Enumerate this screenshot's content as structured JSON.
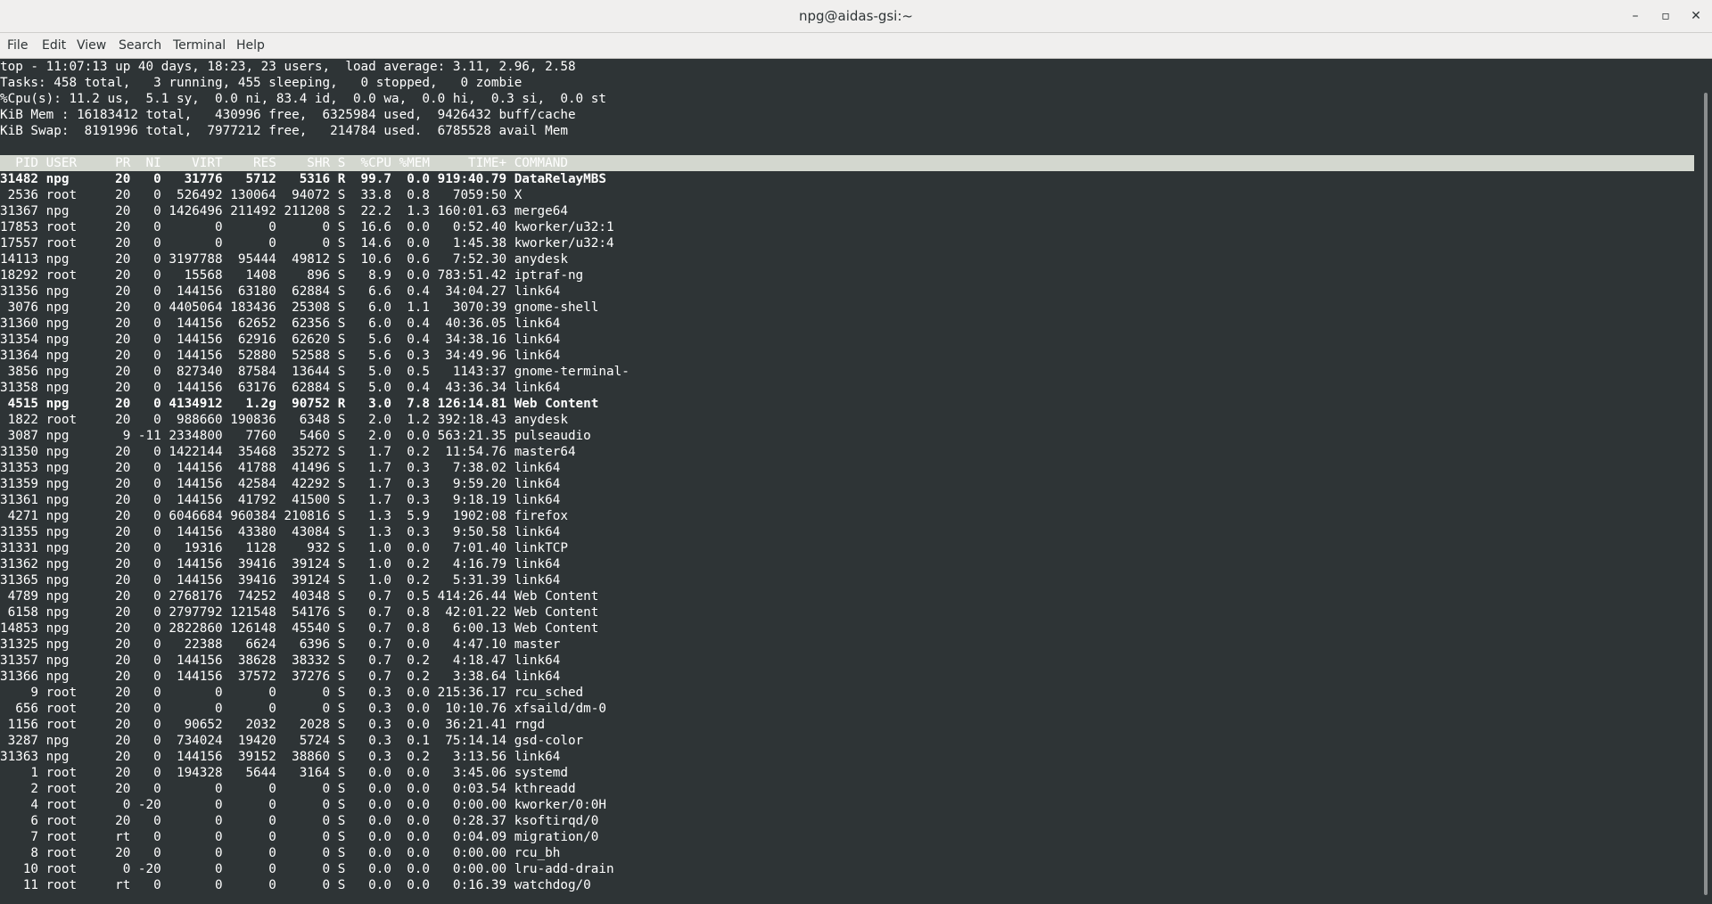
{
  "window": {
    "title": "npg@aidas-gsi:~",
    "minimize_label": "–",
    "maximize_label": "▫",
    "close_label": "✕"
  },
  "menu": [
    "File",
    "Edit",
    "View",
    "Search",
    "Terminal",
    "Help"
  ],
  "summary": [
    "top - 11:07:13 up 40 days, 18:23, 23 users,  load average: 3.11, 2.96, 2.58",
    "Tasks: 458 total,   3 running, 455 sleeping,   0 stopped,   0 zombie",
    "%Cpu(s): 11.2 us,  5.1 sy,  0.0 ni, 83.4 id,  0.0 wa,  0.0 hi,  0.3 si,  0.0 st",
    "KiB Mem : 16183412 total,   430996 free,  6325984 used,  9426432 buff/cache",
    "KiB Swap:  8191996 total,  7977212 free,   214784 used.  6785528 avail Mem"
  ],
  "columns": [
    "PID",
    "USER",
    "PR",
    "NI",
    "VIRT",
    "RES",
    "SHR",
    "S",
    "%CPU",
    "%MEM",
    "TIME+",
    "COMMAND"
  ],
  "processes": [
    {
      "pid": "31482",
      "user": "npg",
      "pr": "20",
      "ni": "0",
      "virt": "31776",
      "res": "5712",
      "shr": "5316",
      "s": "R",
      "cpu": "99.7",
      "mem": "0.0",
      "time": "919:40.79",
      "cmd": "DataRelayMBS",
      "bold": true
    },
    {
      "pid": "2536",
      "user": "root",
      "pr": "20",
      "ni": "0",
      "virt": "526492",
      "res": "130064",
      "shr": "94072",
      "s": "S",
      "cpu": "33.8",
      "mem": "0.8",
      "time": "7059:50",
      "cmd": "X"
    },
    {
      "pid": "31367",
      "user": "npg",
      "pr": "20",
      "ni": "0",
      "virt": "1426496",
      "res": "211492",
      "shr": "211208",
      "s": "S",
      "cpu": "22.2",
      "mem": "1.3",
      "time": "160:01.63",
      "cmd": "merge64"
    },
    {
      "pid": "17853",
      "user": "root",
      "pr": "20",
      "ni": "0",
      "virt": "0",
      "res": "0",
      "shr": "0",
      "s": "S",
      "cpu": "16.6",
      "mem": "0.0",
      "time": "0:52.40",
      "cmd": "kworker/u32:1"
    },
    {
      "pid": "17557",
      "user": "root",
      "pr": "20",
      "ni": "0",
      "virt": "0",
      "res": "0",
      "shr": "0",
      "s": "S",
      "cpu": "14.6",
      "mem": "0.0",
      "time": "1:45.38",
      "cmd": "kworker/u32:4"
    },
    {
      "pid": "14113",
      "user": "npg",
      "pr": "20",
      "ni": "0",
      "virt": "3197788",
      "res": "95444",
      "shr": "49812",
      "s": "S",
      "cpu": "10.6",
      "mem": "0.6",
      "time": "7:52.30",
      "cmd": "anydesk"
    },
    {
      "pid": "18292",
      "user": "root",
      "pr": "20",
      "ni": "0",
      "virt": "15568",
      "res": "1408",
      "shr": "896",
      "s": "S",
      "cpu": "8.9",
      "mem": "0.0",
      "time": "783:51.42",
      "cmd": "iptraf-ng"
    },
    {
      "pid": "31356",
      "user": "npg",
      "pr": "20",
      "ni": "0",
      "virt": "144156",
      "res": "63180",
      "shr": "62884",
      "s": "S",
      "cpu": "6.6",
      "mem": "0.4",
      "time": "34:04.27",
      "cmd": "link64"
    },
    {
      "pid": "3076",
      "user": "npg",
      "pr": "20",
      "ni": "0",
      "virt": "4405064",
      "res": "183436",
      "shr": "25308",
      "s": "S",
      "cpu": "6.0",
      "mem": "1.1",
      "time": "3070:39",
      "cmd": "gnome-shell"
    },
    {
      "pid": "31360",
      "user": "npg",
      "pr": "20",
      "ni": "0",
      "virt": "144156",
      "res": "62652",
      "shr": "62356",
      "s": "S",
      "cpu": "6.0",
      "mem": "0.4",
      "time": "40:36.05",
      "cmd": "link64"
    },
    {
      "pid": "31354",
      "user": "npg",
      "pr": "20",
      "ni": "0",
      "virt": "144156",
      "res": "62916",
      "shr": "62620",
      "s": "S",
      "cpu": "5.6",
      "mem": "0.4",
      "time": "34:38.16",
      "cmd": "link64"
    },
    {
      "pid": "31364",
      "user": "npg",
      "pr": "20",
      "ni": "0",
      "virt": "144156",
      "res": "52880",
      "shr": "52588",
      "s": "S",
      "cpu": "5.6",
      "mem": "0.3",
      "time": "34:49.96",
      "cmd": "link64"
    },
    {
      "pid": "3856",
      "user": "npg",
      "pr": "20",
      "ni": "0",
      "virt": "827340",
      "res": "87584",
      "shr": "13644",
      "s": "S",
      "cpu": "5.0",
      "mem": "0.5",
      "time": "1143:37",
      "cmd": "gnome-terminal-"
    },
    {
      "pid": "31358",
      "user": "npg",
      "pr": "20",
      "ni": "0",
      "virt": "144156",
      "res": "63176",
      "shr": "62884",
      "s": "S",
      "cpu": "5.0",
      "mem": "0.4",
      "time": "43:36.34",
      "cmd": "link64"
    },
    {
      "pid": "4515",
      "user": "npg",
      "pr": "20",
      "ni": "0",
      "virt": "4134912",
      "res": "1.2g",
      "shr": "90752",
      "s": "R",
      "cpu": "3.0",
      "mem": "7.8",
      "time": "126:14.81",
      "cmd": "Web Content",
      "bold": true
    },
    {
      "pid": "1822",
      "user": "root",
      "pr": "20",
      "ni": "0",
      "virt": "988660",
      "res": "190836",
      "shr": "6348",
      "s": "S",
      "cpu": "2.0",
      "mem": "1.2",
      "time": "392:18.43",
      "cmd": "anydesk"
    },
    {
      "pid": "3087",
      "user": "npg",
      "pr": "9",
      "ni": "-11",
      "virt": "2334800",
      "res": "7760",
      "shr": "5460",
      "s": "S",
      "cpu": "2.0",
      "mem": "0.0",
      "time": "563:21.35",
      "cmd": "pulseaudio"
    },
    {
      "pid": "31350",
      "user": "npg",
      "pr": "20",
      "ni": "0",
      "virt": "1422144",
      "res": "35468",
      "shr": "35272",
      "s": "S",
      "cpu": "1.7",
      "mem": "0.2",
      "time": "11:54.76",
      "cmd": "master64"
    },
    {
      "pid": "31353",
      "user": "npg",
      "pr": "20",
      "ni": "0",
      "virt": "144156",
      "res": "41788",
      "shr": "41496",
      "s": "S",
      "cpu": "1.7",
      "mem": "0.3",
      "time": "7:38.02",
      "cmd": "link64"
    },
    {
      "pid": "31359",
      "user": "npg",
      "pr": "20",
      "ni": "0",
      "virt": "144156",
      "res": "42584",
      "shr": "42292",
      "s": "S",
      "cpu": "1.7",
      "mem": "0.3",
      "time": "9:59.20",
      "cmd": "link64"
    },
    {
      "pid": "31361",
      "user": "npg",
      "pr": "20",
      "ni": "0",
      "virt": "144156",
      "res": "41792",
      "shr": "41500",
      "s": "S",
      "cpu": "1.7",
      "mem": "0.3",
      "time": "9:18.19",
      "cmd": "link64"
    },
    {
      "pid": "4271",
      "user": "npg",
      "pr": "20",
      "ni": "0",
      "virt": "6046684",
      "res": "960384",
      "shr": "210816",
      "s": "S",
      "cpu": "1.3",
      "mem": "5.9",
      "time": "1902:08",
      "cmd": "firefox"
    },
    {
      "pid": "31355",
      "user": "npg",
      "pr": "20",
      "ni": "0",
      "virt": "144156",
      "res": "43380",
      "shr": "43084",
      "s": "S",
      "cpu": "1.3",
      "mem": "0.3",
      "time": "9:50.58",
      "cmd": "link64"
    },
    {
      "pid": "31331",
      "user": "npg",
      "pr": "20",
      "ni": "0",
      "virt": "19316",
      "res": "1128",
      "shr": "932",
      "s": "S",
      "cpu": "1.0",
      "mem": "0.0",
      "time": "7:01.40",
      "cmd": "linkTCP"
    },
    {
      "pid": "31362",
      "user": "npg",
      "pr": "20",
      "ni": "0",
      "virt": "144156",
      "res": "39416",
      "shr": "39124",
      "s": "S",
      "cpu": "1.0",
      "mem": "0.2",
      "time": "4:16.79",
      "cmd": "link64"
    },
    {
      "pid": "31365",
      "user": "npg",
      "pr": "20",
      "ni": "0",
      "virt": "144156",
      "res": "39416",
      "shr": "39124",
      "s": "S",
      "cpu": "1.0",
      "mem": "0.2",
      "time": "5:31.39",
      "cmd": "link64"
    },
    {
      "pid": "4789",
      "user": "npg",
      "pr": "20",
      "ni": "0",
      "virt": "2768176",
      "res": "74252",
      "shr": "40348",
      "s": "S",
      "cpu": "0.7",
      "mem": "0.5",
      "time": "414:26.44",
      "cmd": "Web Content"
    },
    {
      "pid": "6158",
      "user": "npg",
      "pr": "20",
      "ni": "0",
      "virt": "2797792",
      "res": "121548",
      "shr": "54176",
      "s": "S",
      "cpu": "0.7",
      "mem": "0.8",
      "time": "42:01.22",
      "cmd": "Web Content"
    },
    {
      "pid": "14853",
      "user": "npg",
      "pr": "20",
      "ni": "0",
      "virt": "2822860",
      "res": "126148",
      "shr": "45540",
      "s": "S",
      "cpu": "0.7",
      "mem": "0.8",
      "time": "6:00.13",
      "cmd": "Web Content"
    },
    {
      "pid": "31325",
      "user": "npg",
      "pr": "20",
      "ni": "0",
      "virt": "22388",
      "res": "6624",
      "shr": "6396",
      "s": "S",
      "cpu": "0.7",
      "mem": "0.0",
      "time": "4:47.10",
      "cmd": "master"
    },
    {
      "pid": "31357",
      "user": "npg",
      "pr": "20",
      "ni": "0",
      "virt": "144156",
      "res": "38628",
      "shr": "38332",
      "s": "S",
      "cpu": "0.7",
      "mem": "0.2",
      "time": "4:18.47",
      "cmd": "link64"
    },
    {
      "pid": "31366",
      "user": "npg",
      "pr": "20",
      "ni": "0",
      "virt": "144156",
      "res": "37572",
      "shr": "37276",
      "s": "S",
      "cpu": "0.7",
      "mem": "0.2",
      "time": "3:38.64",
      "cmd": "link64"
    },
    {
      "pid": "9",
      "user": "root",
      "pr": "20",
      "ni": "0",
      "virt": "0",
      "res": "0",
      "shr": "0",
      "s": "S",
      "cpu": "0.3",
      "mem": "0.0",
      "time": "215:36.17",
      "cmd": "rcu_sched"
    },
    {
      "pid": "656",
      "user": "root",
      "pr": "20",
      "ni": "0",
      "virt": "0",
      "res": "0",
      "shr": "0",
      "s": "S",
      "cpu": "0.3",
      "mem": "0.0",
      "time": "10:10.76",
      "cmd": "xfsaild/dm-0"
    },
    {
      "pid": "1156",
      "user": "root",
      "pr": "20",
      "ni": "0",
      "virt": "90652",
      "res": "2032",
      "shr": "2028",
      "s": "S",
      "cpu": "0.3",
      "mem": "0.0",
      "time": "36:21.41",
      "cmd": "rngd"
    },
    {
      "pid": "3287",
      "user": "npg",
      "pr": "20",
      "ni": "0",
      "virt": "734024",
      "res": "19420",
      "shr": "5724",
      "s": "S",
      "cpu": "0.3",
      "mem": "0.1",
      "time": "75:14.14",
      "cmd": "gsd-color"
    },
    {
      "pid": "31363",
      "user": "npg",
      "pr": "20",
      "ni": "0",
      "virt": "144156",
      "res": "39152",
      "shr": "38860",
      "s": "S",
      "cpu": "0.3",
      "mem": "0.2",
      "time": "3:13.56",
      "cmd": "link64"
    },
    {
      "pid": "1",
      "user": "root",
      "pr": "20",
      "ni": "0",
      "virt": "194328",
      "res": "5644",
      "shr": "3164",
      "s": "S",
      "cpu": "0.0",
      "mem": "0.0",
      "time": "3:45.06",
      "cmd": "systemd"
    },
    {
      "pid": "2",
      "user": "root",
      "pr": "20",
      "ni": "0",
      "virt": "0",
      "res": "0",
      "shr": "0",
      "s": "S",
      "cpu": "0.0",
      "mem": "0.0",
      "time": "0:03.54",
      "cmd": "kthreadd"
    },
    {
      "pid": "4",
      "user": "root",
      "pr": "0",
      "ni": "-20",
      "virt": "0",
      "res": "0",
      "shr": "0",
      "s": "S",
      "cpu": "0.0",
      "mem": "0.0",
      "time": "0:00.00",
      "cmd": "kworker/0:0H"
    },
    {
      "pid": "6",
      "user": "root",
      "pr": "20",
      "ni": "0",
      "virt": "0",
      "res": "0",
      "shr": "0",
      "s": "S",
      "cpu": "0.0",
      "mem": "0.0",
      "time": "0:28.37",
      "cmd": "ksoftirqd/0"
    },
    {
      "pid": "7",
      "user": "root",
      "pr": "rt",
      "ni": "0",
      "virt": "0",
      "res": "0",
      "shr": "0",
      "s": "S",
      "cpu": "0.0",
      "mem": "0.0",
      "time": "0:04.09",
      "cmd": "migration/0"
    },
    {
      "pid": "8",
      "user": "root",
      "pr": "20",
      "ni": "0",
      "virt": "0",
      "res": "0",
      "shr": "0",
      "s": "S",
      "cpu": "0.0",
      "mem": "0.0",
      "time": "0:00.00",
      "cmd": "rcu_bh"
    },
    {
      "pid": "10",
      "user": "root",
      "pr": "0",
      "ni": "-20",
      "virt": "0",
      "res": "0",
      "shr": "0",
      "s": "S",
      "cpu": "0.0",
      "mem": "0.0",
      "time": "0:00.00",
      "cmd": "lru-add-drain"
    },
    {
      "pid": "11",
      "user": "root",
      "pr": "rt",
      "ni": "0",
      "virt": "0",
      "res": "0",
      "shr": "0",
      "s": "S",
      "cpu": "0.0",
      "mem": "0.0",
      "time": "0:16.39",
      "cmd": "watchdog/0"
    }
  ],
  "colors": {
    "terminal_bg": "#2e3436",
    "terminal_fg": "#ffffff",
    "header_bg": "#d3d7cf",
    "chrome_bg": "#f0efee"
  }
}
